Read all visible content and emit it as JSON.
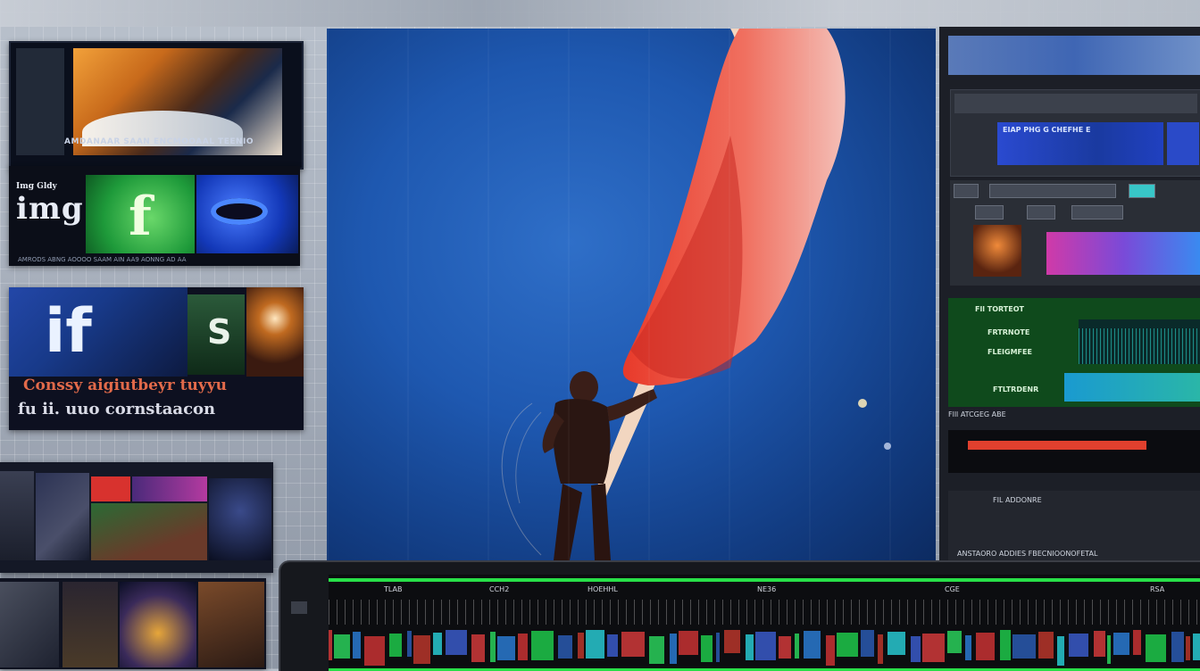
{
  "left_panels": {
    "p1_caption": "AMDANAAR SAAN ENCMOOAAL TEENIO",
    "p2_brand_small": "Img Gldy",
    "p2_brand_big": "img",
    "p2_tile_letter": "f",
    "p2_footer": "AMRODS ABNG AOOOO SAAM AIN AA9 AONNG AD AA",
    "p3_tile_text": "if",
    "p3_tile_s": "S",
    "p3_text1": "Conssy aigiutbeyr tuyyu",
    "p3_text2": "fu ii. uuo cornstaacon"
  },
  "right_panel": {
    "shot_text": "EIAP PHG G CHEFHE E",
    "green_rows": [
      "Fll TORTEOT",
      "FRTRNOTE",
      "FLEIGMFEE",
      "FTLTRDENR"
    ],
    "controls_text": "Flll ATCGEG ABE",
    "bottom_labels": [
      "FIL ADDONRE",
      "ANSTAORO ADDIES  FBECNIOONOFETAL"
    ]
  },
  "timeline": {
    "labels": [
      "TLAB",
      "CCH2",
      "HOEHHL",
      "NE36",
      "CGE",
      "RSA"
    ],
    "clip_colors": [
      "#d03a3a",
      "#2a7ad0",
      "#1ec84a",
      "#b8362a",
      "#3a5ac8",
      "#2ad05a",
      "#c83232",
      "#2a5ab0",
      "#28c8d0"
    ]
  },
  "colors": {
    "accent_green": "#28e048",
    "accent_red": "#e0402e",
    "sky_blue": "#1e58b0",
    "flag_red": "#e84a3a"
  },
  "icons": [
    "dock-square-icon",
    "timeline-side-icon"
  ]
}
